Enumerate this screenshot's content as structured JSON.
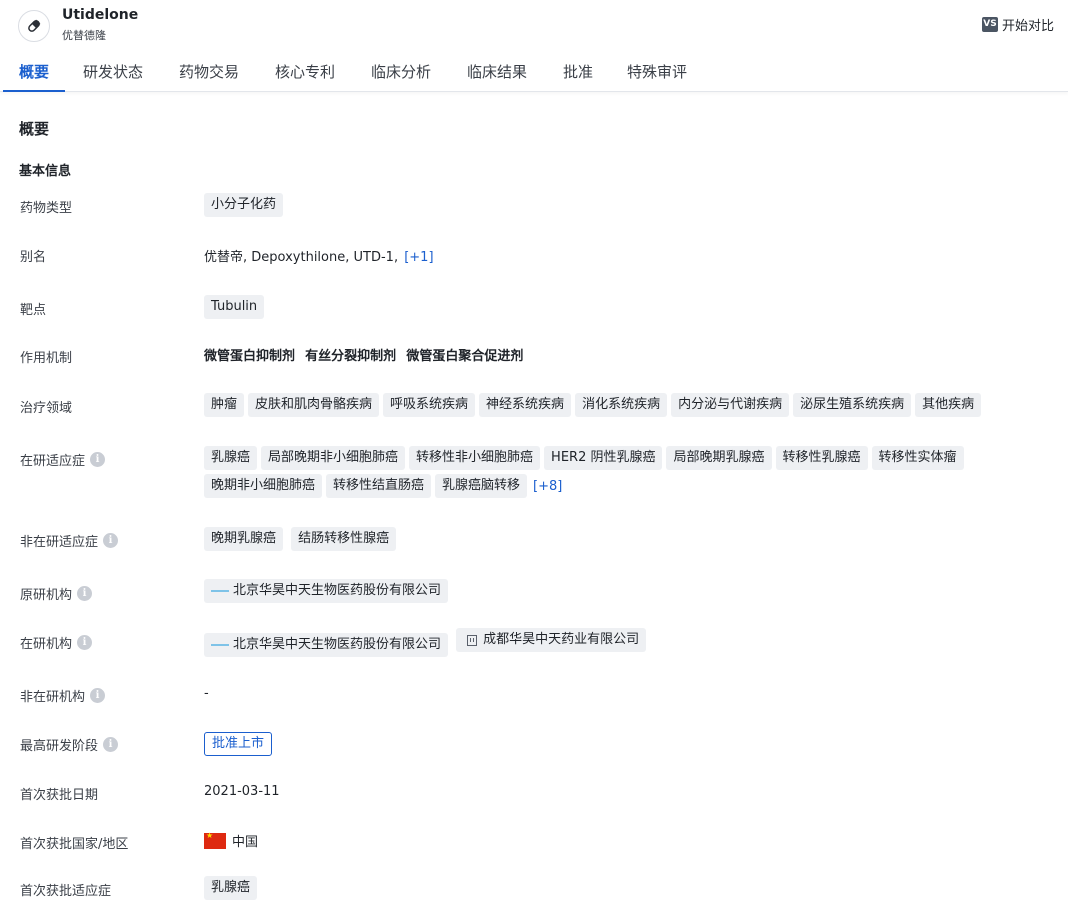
{
  "header": {
    "drug_name": "Utidelone",
    "drug_name_cn": "优替德隆",
    "compare_badge": "VS",
    "compare_label": "开始对比"
  },
  "tabs": [
    {
      "label": "概要",
      "active": true
    },
    {
      "label": "研发状态"
    },
    {
      "label": "药物交易"
    },
    {
      "label": "核心专利"
    },
    {
      "label": "临床分析"
    },
    {
      "label": "临床结果"
    },
    {
      "label": "批准"
    },
    {
      "label": "特殊审评"
    }
  ],
  "section_title": "概要",
  "basic_info_title": "基本信息",
  "info": {
    "drug_type": {
      "label": "药物类型",
      "tags": [
        "小分子化药"
      ]
    },
    "alias": {
      "label": "别名",
      "values": [
        "优替帝,",
        "Depoxythilone,",
        "UTD-1,"
      ],
      "more": "[+1]"
    },
    "target": {
      "label": "靶点",
      "tags": [
        "Tubulin"
      ]
    },
    "mechanism": {
      "label": "作用机制",
      "values": [
        "微管蛋白抑制剂",
        "有丝分裂抑制剂",
        "微管蛋白聚合促进剂"
      ]
    },
    "therapeutic_area": {
      "label": "治疗领域",
      "tags": [
        "肿瘤",
        "皮肤和肌肉骨骼疾病",
        "呼吸系统疾病",
        "神经系统疾病",
        "消化系统疾病",
        "内分泌与代谢疾病",
        "泌尿生殖系统疾病",
        "其他疾病"
      ]
    },
    "active_indications": {
      "label": "在研适应症",
      "tags_line1": [
        "乳腺癌",
        "局部晚期非小细胞肺癌",
        "转移性非小细胞肺癌",
        "HER2 阴性乳腺癌",
        "局部晚期乳腺癌",
        "转移性乳腺癌",
        "转移性实体瘤"
      ],
      "tags_line2": [
        "晚期非小细胞肺癌",
        "转移性结直肠癌",
        "乳腺癌脑转移"
      ],
      "more": "[+8]"
    },
    "inactive_indications": {
      "label": "非在研适应症",
      "tags": [
        "晚期乳腺癌",
        "结肠转移性腺癌"
      ]
    },
    "originator": {
      "label": "原研机构",
      "orgs": [
        "北京华昊中天生物医药股份有限公司"
      ]
    },
    "active_orgs": {
      "label": "在研机构",
      "orgs": [
        "北京华昊中天生物医药股份有限公司",
        "成都华昊中天药业有限公司"
      ]
    },
    "inactive_orgs": {
      "label": "非在研机构",
      "value": "-"
    },
    "highest_phase": {
      "label": "最高研发阶段",
      "value": "批准上市"
    },
    "first_approval_date": {
      "label": "首次获批日期",
      "value": "2021-03-11"
    },
    "first_approval_country": {
      "label": "首次获批国家/地区",
      "value": "中国"
    },
    "first_approval_indication": {
      "label": "首次获批适应症",
      "tags": [
        "乳腺癌"
      ]
    }
  },
  "colors": {
    "accent": "#1b5fce",
    "tag_bg": "#eef0f3",
    "flag_red": "#de2910"
  }
}
